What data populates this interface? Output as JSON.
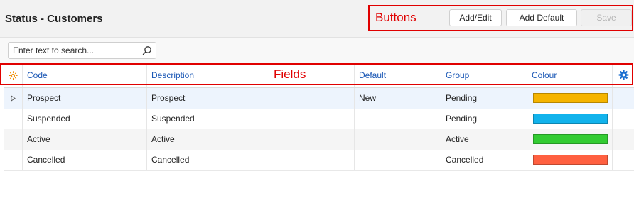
{
  "page": {
    "title": "Status - Customers"
  },
  "buttons": {
    "add_edit": "Add/Edit",
    "add_default": "Add Default",
    "save": "Save"
  },
  "annotations": {
    "buttons_label": "Buttons",
    "fields_label": "Fields",
    "color": "#e00000"
  },
  "search": {
    "placeholder": "Enter text to search...",
    "value": ""
  },
  "grid": {
    "columns": {
      "code": "Code",
      "description": "Description",
      "default": "Default",
      "group": "Group",
      "colour": "Colour"
    },
    "header_icons": {
      "left": "sun-icon",
      "right": "gear-icon"
    },
    "rows": [
      {
        "code": "Prospect",
        "description": "Prospect",
        "default": "New",
        "group": "Pending",
        "colour": "#f5b400",
        "selected": true
      },
      {
        "code": "Suspended",
        "description": "Suspended",
        "default": "",
        "group": "Pending",
        "colour": "#12b3ec",
        "selected": false
      },
      {
        "code": "Active",
        "description": "Active",
        "default": "",
        "group": "Active",
        "colour": "#33cc33",
        "selected": false
      },
      {
        "code": "Cancelled",
        "description": "Cancelled",
        "default": "",
        "group": "Cancelled",
        "colour": "#ff6040",
        "selected": false
      }
    ]
  },
  "colors": {
    "accent": "#1a57b5",
    "selected_row": "#edf4fd",
    "alt_row": "#f5f5f5"
  }
}
